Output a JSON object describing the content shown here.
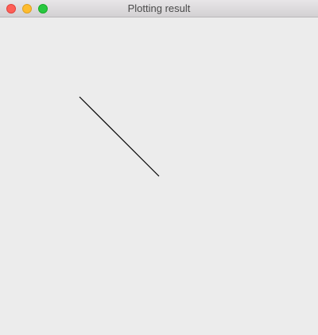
{
  "window": {
    "title": "Plotting result",
    "controls": {
      "close_color": "#fe5f57",
      "minimize_color": "#febc2e",
      "zoom_color": "#28c840"
    }
  },
  "plot": {
    "stroke_color": "#000000",
    "background_color": "#ececec"
  }
}
